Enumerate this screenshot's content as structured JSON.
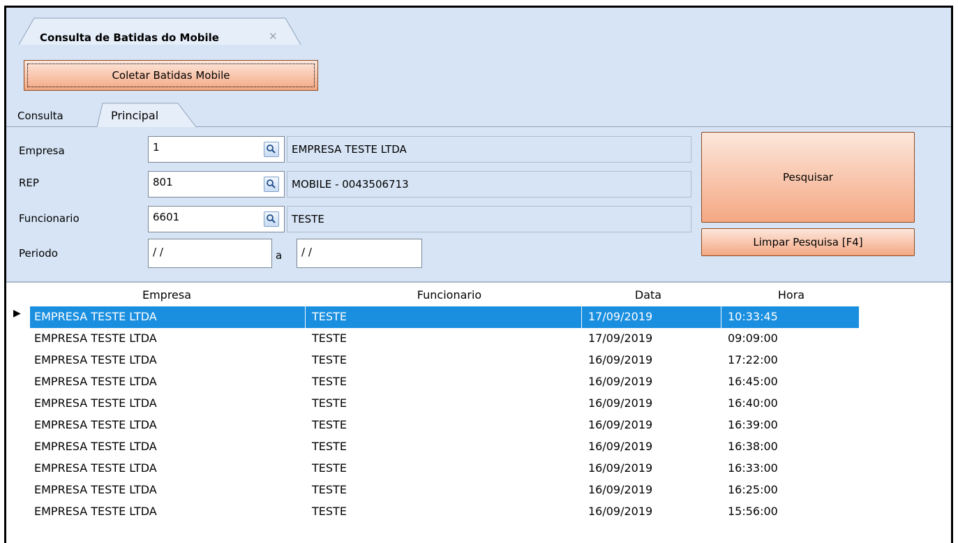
{
  "document_tab": {
    "title": "Consulta de Batidas do Mobile",
    "close": "✕"
  },
  "buttons": {
    "coletar": "Coletar Batidas Mobile",
    "pesquisar": "Pesquisar",
    "limpar": "Limpar Pesquisa [F4]"
  },
  "tabs": [
    {
      "label": "Consulta"
    },
    {
      "label": "Principal"
    }
  ],
  "form": {
    "empresa": {
      "label": "Empresa",
      "code": "1",
      "description": "EMPRESA TESTE LTDA"
    },
    "rep": {
      "label": "REP",
      "code": "801",
      "description": "MOBILE - 0043506713"
    },
    "funcionario": {
      "label": "Funcionario",
      "code": "6601",
      "description": "TESTE"
    },
    "periodo": {
      "label": "Periodo",
      "from": "/ /",
      "separator": "a",
      "to": "/ /"
    }
  },
  "grid": {
    "columns": [
      "Empresa",
      "Funcionario",
      "Data",
      "Hora"
    ],
    "selected_marker": "▶",
    "rows": [
      [
        "EMPRESA TESTE LTDA",
        "TESTE",
        "17/09/2019",
        "10:33:45"
      ],
      [
        "EMPRESA TESTE LTDA",
        "TESTE",
        "17/09/2019",
        "09:09:00"
      ],
      [
        "EMPRESA TESTE LTDA",
        "TESTE",
        "16/09/2019",
        "17:22:00"
      ],
      [
        "EMPRESA TESTE LTDA",
        "TESTE",
        "16/09/2019",
        "16:45:00"
      ],
      [
        "EMPRESA TESTE LTDA",
        "TESTE",
        "16/09/2019",
        "16:40:00"
      ],
      [
        "EMPRESA TESTE LTDA",
        "TESTE",
        "16/09/2019",
        "16:39:00"
      ],
      [
        "EMPRESA TESTE LTDA",
        "TESTE",
        "16/09/2019",
        "16:38:00"
      ],
      [
        "EMPRESA TESTE LTDA",
        "TESTE",
        "16/09/2019",
        "16:33:00"
      ],
      [
        "EMPRESA TESTE LTDA",
        "TESTE",
        "16/09/2019",
        "16:25:00"
      ],
      [
        "EMPRESA TESTE LTDA",
        "TESTE",
        "16/09/2019",
        "15:56:00"
      ]
    ]
  },
  "colors": {
    "panel_bg": "#d6e4f5",
    "button_orange": "#f4a883",
    "selection": "#1a8fe0"
  }
}
